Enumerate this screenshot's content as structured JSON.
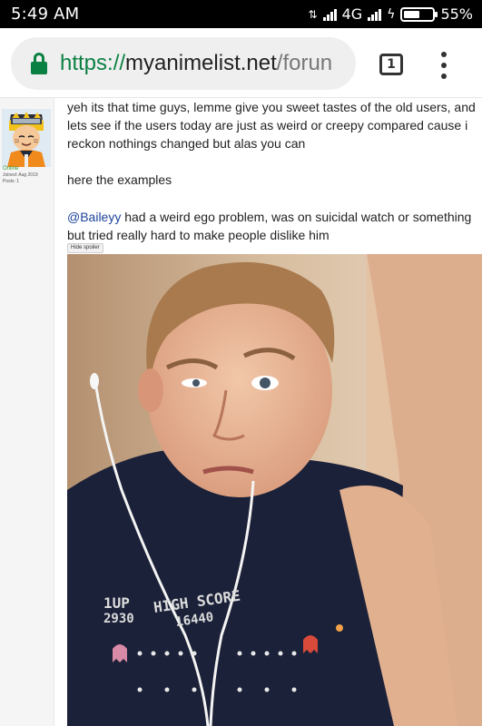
{
  "status_bar": {
    "time": "5:49 AM",
    "network": "4G",
    "battery": "55%",
    "battery_level": 0.55
  },
  "browser": {
    "url_scheme": "https://",
    "url_host": "myanimelist.net",
    "url_path": "/forun",
    "tab_count": "1",
    "icons": [
      "lock-icon",
      "tabs-icon",
      "overflow-menu-icon"
    ]
  },
  "user": {
    "status": "Online",
    "joined": "Joined: Aug 2019",
    "posts": "Posts: 1"
  },
  "post": {
    "paragraph1": "yeh its that time guys, lemme give you sweet tastes of the old users, and lets see if the users today are just as weird or creepy compared cause i reckon nothings changed but alas you can",
    "paragraph2": "here the examples",
    "mention": "@Baileyy",
    "paragraph3_rest": " had a weird ego problem, was on suicidal watch or something but tried really hard to make people dislike him",
    "spoiler_button": "Hide spoiler"
  },
  "photo": {
    "shirt_text_line1": "1UP",
    "shirt_text_line2": "2930",
    "shirt_text_line3": "HIGH SCORE",
    "shirt_text_line4": "16440"
  },
  "colors": {
    "secure_green": "#0b8043",
    "mention_blue": "#1d439b",
    "online_green": "#2e9a3a"
  }
}
